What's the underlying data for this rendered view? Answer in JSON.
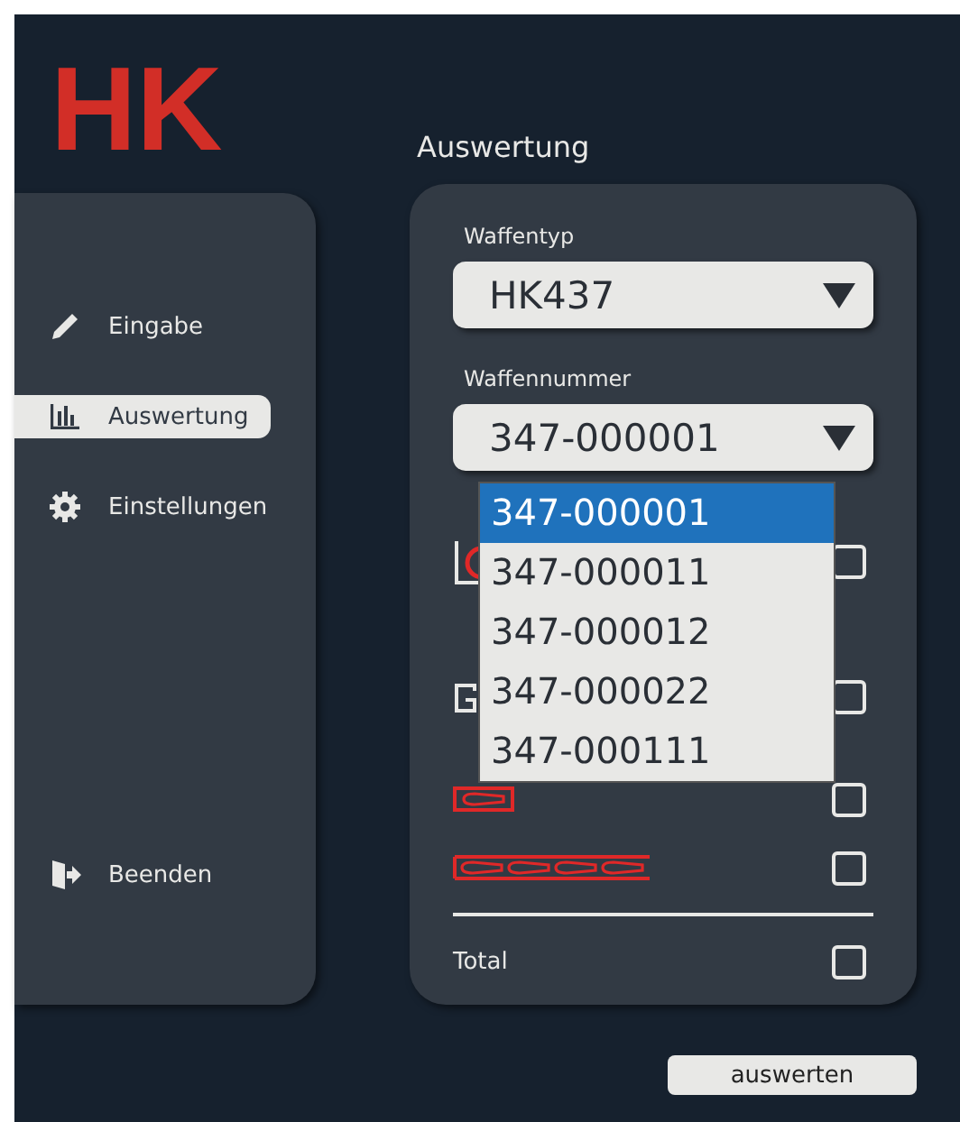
{
  "logo": {
    "text": "HK"
  },
  "sidebar": {
    "items": [
      {
        "label": "Eingabe",
        "selected": false
      },
      {
        "label": "Auswertung",
        "selected": true
      },
      {
        "label": "Einstellungen",
        "selected": false
      }
    ],
    "exit": {
      "label": "Beenden"
    }
  },
  "title": "Auswertung",
  "weapon_type": {
    "label": "Waffentyp",
    "value": "HK437"
  },
  "weapon_number": {
    "label": "Waffennummer",
    "value": "347-000001",
    "expanded": true,
    "options": [
      {
        "label": "347-000001",
        "selected": true
      },
      {
        "label": "347-000011",
        "selected": false
      },
      {
        "label": "347-000012",
        "selected": false
      },
      {
        "label": "347-000022",
        "selected": false
      },
      {
        "label": "347-000111",
        "selected": false
      }
    ]
  },
  "rows": [
    {
      "kind": "chart",
      "checked": false
    },
    {
      "kind": "group",
      "checked": false
    },
    {
      "kind": "single",
      "checked": false
    },
    {
      "kind": "series",
      "checked": false
    }
  ],
  "total": {
    "label": "Total",
    "checked": false
  },
  "button": "auswerten"
}
